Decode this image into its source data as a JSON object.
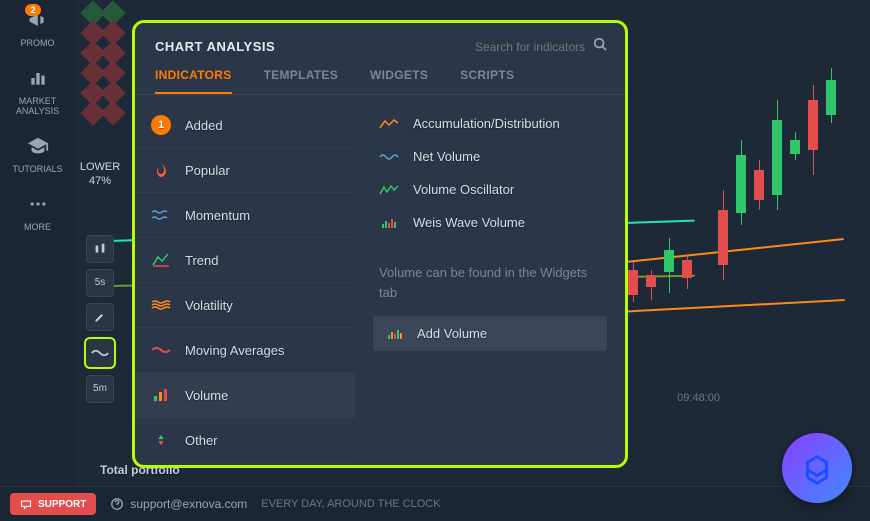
{
  "sidebar": {
    "promo": {
      "label": "PROMO",
      "badge": "2"
    },
    "market": {
      "label": "MARKET ANALYSIS"
    },
    "tutorials": {
      "label": "TUTORIALS"
    },
    "more": {
      "label": "MORE"
    }
  },
  "toolbar": {
    "lower_label": "LOWER",
    "lower_pct": "47%",
    "tf1": "5s",
    "tf2": "5m"
  },
  "popover": {
    "title": "CHART ANALYSIS",
    "search_placeholder": "Search for indicators",
    "tabs": {
      "indicators": "INDICATORS",
      "templates": "TEMPLATES",
      "widgets": "WIDGETS",
      "scripts": "SCRIPTS"
    },
    "categories": {
      "added": {
        "label": "Added",
        "count": "1"
      },
      "popular": "Popular",
      "momentum": "Momentum",
      "trend": "Trend",
      "volatility": "Volatility",
      "moving_avg": "Moving Averages",
      "volume": "Volume",
      "other": "Other"
    },
    "indicators": {
      "accum": "Accumulation/Distribution",
      "netvol": "Net Volume",
      "volosc": "Volume Oscillator",
      "weis": "Weis Wave Volume"
    },
    "hint": "Volume can be found in the Widgets tab",
    "add_volume": "Add Volume"
  },
  "chart": {
    "time": "09:48:00"
  },
  "footer": {
    "support_btn": "SUPPORT",
    "email": "support@exnova.com",
    "hours": "EVERY DAY, AROUND THE CLOCK",
    "portfolio": "Total portfolio"
  }
}
